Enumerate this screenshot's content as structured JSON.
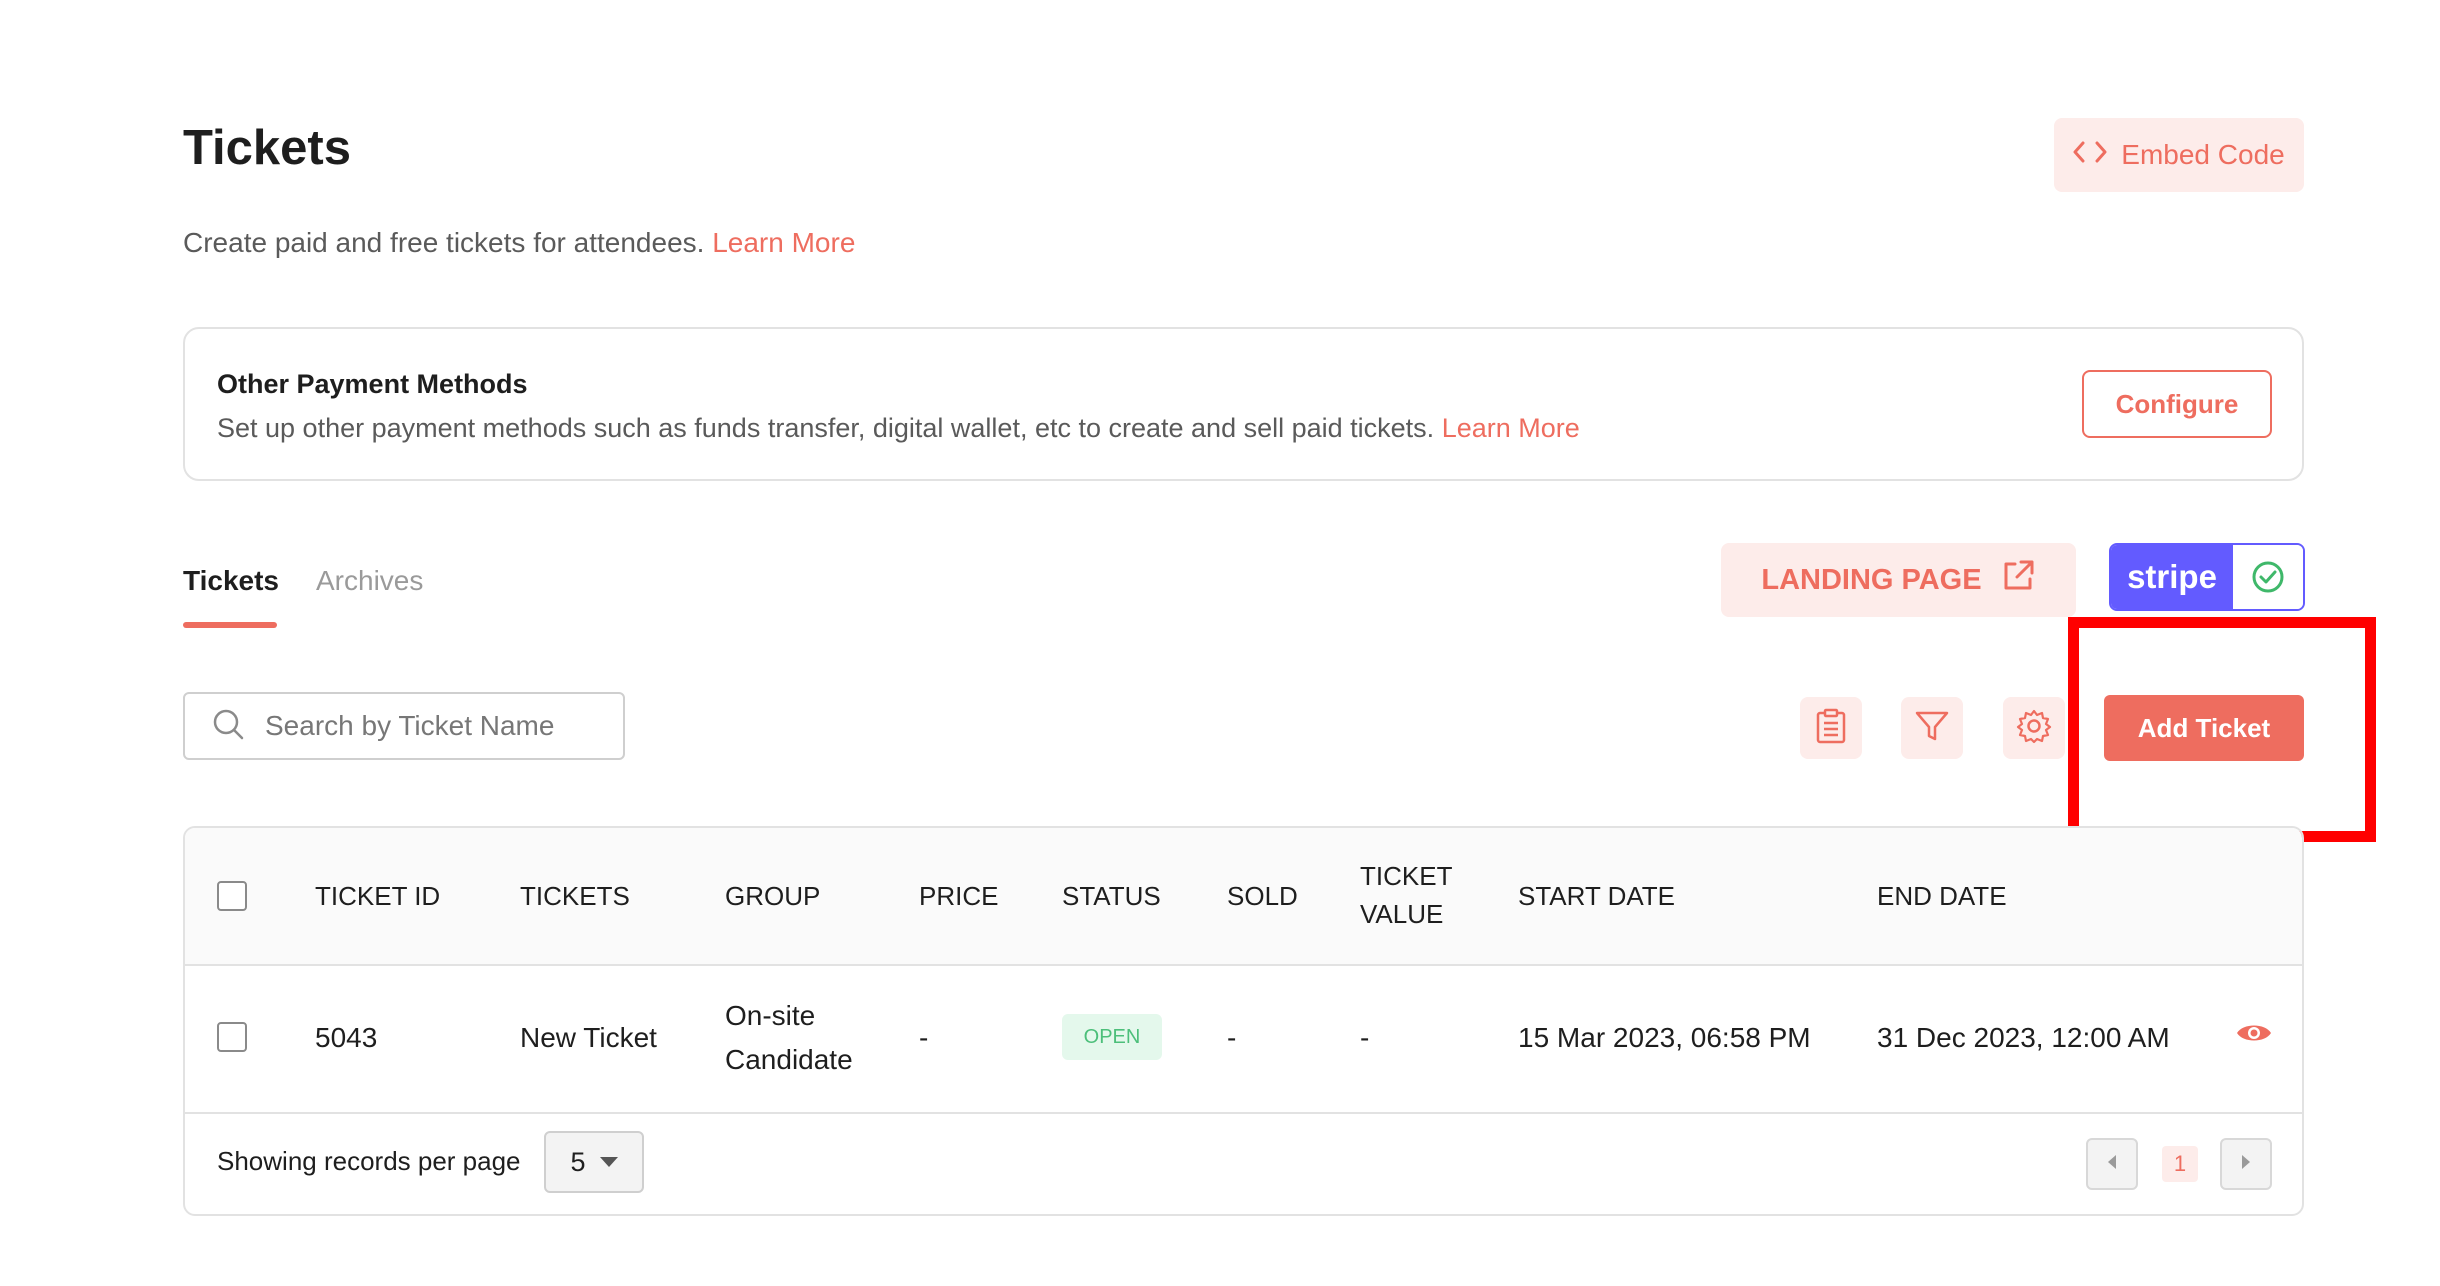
{
  "header": {
    "title": "Tickets",
    "subtitle": "Create paid and free tickets for attendees.",
    "subtitle_link": "Learn More",
    "embed_label": "Embed Code"
  },
  "payment_card": {
    "title": "Other Payment Methods",
    "description": "Set up other payment methods such as funds transfer, digital wallet, etc to create and sell paid tickets.",
    "link": "Learn More",
    "configure_label": "Configure"
  },
  "tabs": [
    {
      "label": "Tickets",
      "active": true
    },
    {
      "label": "Archives",
      "active": false
    }
  ],
  "landing_page_label": "LANDING PAGE",
  "stripe": {
    "label": "stripe",
    "brand_color": "#635bff",
    "connected": true
  },
  "search": {
    "placeholder": "Search by Ticket Name"
  },
  "toolbar": {
    "icons": [
      "clipboard-icon",
      "filter-icon",
      "gear-icon"
    ],
    "add_ticket_label": "Add Ticket"
  },
  "table": {
    "columns": [
      "TICKET ID",
      "TICKETS",
      "GROUP",
      "PRICE",
      "STATUS",
      "SOLD",
      "TICKET VALUE",
      "START DATE",
      "END DATE"
    ],
    "rows": [
      {
        "ticket_id": "5043",
        "ticket": "New Ticket",
        "group": "On-site Candidate",
        "price": "-",
        "status": "OPEN",
        "sold": "-",
        "ticket_value": "-",
        "start_date": "15 Mar 2023, 06:58 PM",
        "end_date": "31 Dec 2023, 12:00 AM"
      }
    ]
  },
  "footer": {
    "per_page_label": "Showing records per page",
    "per_page_value": "5",
    "current_page": "1"
  },
  "colors": {
    "accent": "#ee6d5f",
    "accent_light": "#fdecea",
    "open_bg": "#e4f8ec",
    "open_text": "#4cbf7a",
    "highlight": "#ff0000"
  }
}
